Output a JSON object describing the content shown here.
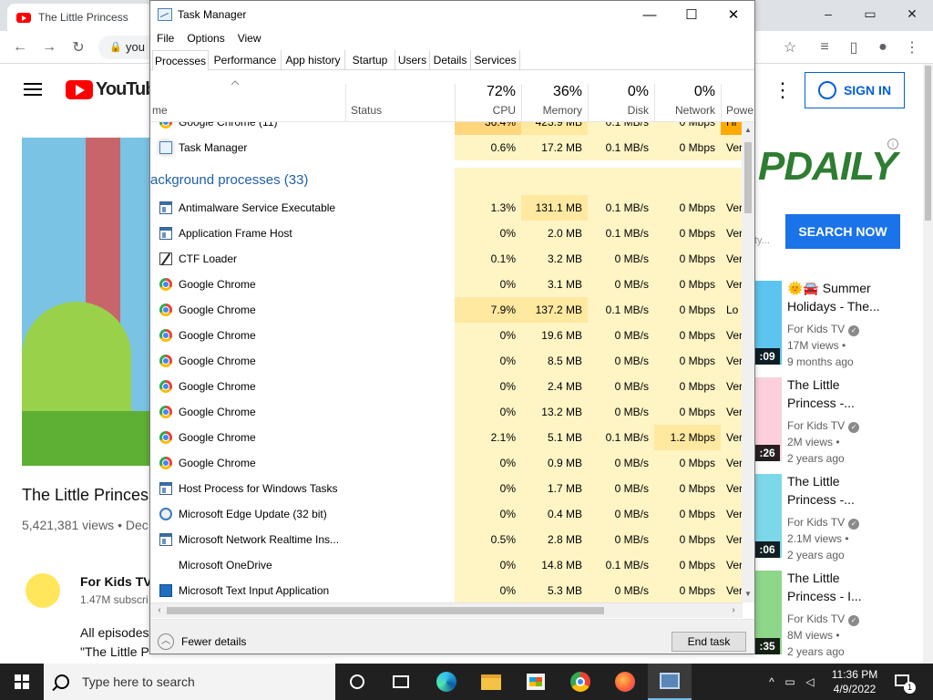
{
  "browser": {
    "tab_title": "The Little Princess",
    "url": "you",
    "window_controls": [
      "–",
      "▭",
      "✕"
    ]
  },
  "youtube": {
    "logo_text": "YouTube",
    "signin_label": "SIGN IN",
    "video_title": "The Little Princes",
    "video_views": "5,421,381 views • Dec",
    "channel_name": "For Kids TV",
    "channel_subs": "1.47M subscri",
    "desc_line1": "All episodes",
    "desc_line2": "\"The Little P",
    "ad_brand": "PDAILY",
    "ad_small": "ty...",
    "ad_button": "SEARCH NOW",
    "related": [
      {
        "line1": "🌞🚘 Summer",
        "line2": "Holidays - The...",
        "channel": "For Kids TV",
        "views": "17M views •",
        "ago": "9 months ago",
        "duration": ":09"
      },
      {
        "line1": "The Little",
        "line2": "Princess -...",
        "channel": "For Kids TV",
        "views": "2M views •",
        "ago": "2 years ago",
        "duration": ":26"
      },
      {
        "line1": "The Little",
        "line2": "Princess -...",
        "channel": "For Kids TV",
        "views": "2.1M views •",
        "ago": "2 years ago",
        "duration": ":06"
      },
      {
        "line1": "The Little",
        "line2": "Princess - I...",
        "channel": "For Kids TV",
        "views": "8M views •",
        "ago": "2 years ago",
        "duration": ":35"
      }
    ]
  },
  "taskmanager": {
    "title": "Task Manager",
    "window_controls": [
      "—",
      "☐",
      "✕"
    ],
    "menu": [
      "File",
      "Options",
      "View"
    ],
    "tabs": [
      "Processes",
      "Performance",
      "App history",
      "Startup",
      "Users",
      "Details",
      "Services"
    ],
    "active_tab": "Processes",
    "columns": {
      "name": "me",
      "status": "Status",
      "cpu_pct": "72%",
      "cpu": "CPU",
      "mem_pct": "36%",
      "mem": "Memory",
      "disk_pct": "0%",
      "disk": "Disk",
      "net_pct": "0%",
      "net": "Network",
      "power": "Powe"
    },
    "partial_row": {
      "name": "Google Chrome (11)",
      "cpu": "36.4%",
      "mem": "423.9 MB",
      "disk": "0.1 MB/s",
      "net": "0 Mbps",
      "power": "Hi"
    },
    "apps_rows": [
      {
        "icon": "tm",
        "name": "Task Manager",
        "cpu": "0.6%",
        "mem": "17.2 MB",
        "disk": "0.1 MB/s",
        "net": "0 Mbps",
        "power": "Ver"
      }
    ],
    "group_title": "ackground processes (33)",
    "bg_rows": [
      {
        "icon": "win",
        "name": "Antimalware Service Executable",
        "cpu": "1.3%",
        "mem": "131.1 MB",
        "disk": "0.1 MB/s",
        "net": "0 Mbps",
        "power": "Ver"
      },
      {
        "icon": "win",
        "name": "Application Frame Host",
        "cpu": "0%",
        "mem": "2.0 MB",
        "disk": "0.1 MB/s",
        "net": "0 Mbps",
        "power": "Ver"
      },
      {
        "icon": "ctf",
        "name": "CTF Loader",
        "cpu": "0.1%",
        "mem": "3.2 MB",
        "disk": "0 MB/s",
        "net": "0 Mbps",
        "power": "Ver"
      },
      {
        "icon": "chrome",
        "name": "Google Chrome",
        "cpu": "0%",
        "mem": "3.1 MB",
        "disk": "0 MB/s",
        "net": "0 Mbps",
        "power": "Ver"
      },
      {
        "icon": "chrome",
        "name": "Google Chrome",
        "cpu": "7.9%",
        "mem": "137.2 MB",
        "disk": "0.1 MB/s",
        "net": "0 Mbps",
        "power": "Lo"
      },
      {
        "icon": "chrome",
        "name": "Google Chrome",
        "cpu": "0%",
        "mem": "19.6 MB",
        "disk": "0 MB/s",
        "net": "0 Mbps",
        "power": "Ver"
      },
      {
        "icon": "chrome",
        "name": "Google Chrome",
        "cpu": "0%",
        "mem": "8.5 MB",
        "disk": "0 MB/s",
        "net": "0 Mbps",
        "power": "Ver"
      },
      {
        "icon": "chrome",
        "name": "Google Chrome",
        "cpu": "0%",
        "mem": "2.4 MB",
        "disk": "0 MB/s",
        "net": "0 Mbps",
        "power": "Ver"
      },
      {
        "icon": "chrome",
        "name": "Google Chrome",
        "cpu": "0%",
        "mem": "13.2 MB",
        "disk": "0 MB/s",
        "net": "0 Mbps",
        "power": "Ver"
      },
      {
        "icon": "chrome",
        "name": "Google Chrome",
        "cpu": "2.1%",
        "mem": "5.1 MB",
        "disk": "0.1 MB/s",
        "net": "1.2 Mbps",
        "power": "Ver"
      },
      {
        "icon": "chrome",
        "name": "Google Chrome",
        "cpu": "0%",
        "mem": "0.9 MB",
        "disk": "0 MB/s",
        "net": "0 Mbps",
        "power": "Ver"
      },
      {
        "icon": "win",
        "name": "Host Process for Windows Tasks",
        "cpu": "0%",
        "mem": "1.7 MB",
        "disk": "0 MB/s",
        "net": "0 Mbps",
        "power": "Ver"
      },
      {
        "icon": "edge",
        "name": "Microsoft Edge Update (32 bit)",
        "cpu": "0%",
        "mem": "0.4 MB",
        "disk": "0 MB/s",
        "net": "0 Mbps",
        "power": "Ver"
      },
      {
        "icon": "win",
        "name": "Microsoft Network Realtime Ins...",
        "cpu": "0.5%",
        "mem": "2.8 MB",
        "disk": "0 MB/s",
        "net": "0 Mbps",
        "power": "Ver"
      },
      {
        "icon": "none",
        "name": "Microsoft OneDrive",
        "cpu": "0%",
        "mem": "14.8 MB",
        "disk": "0.1 MB/s",
        "net": "0 Mbps",
        "power": "Ver"
      },
      {
        "icon": "text",
        "name": "Microsoft Text Input Application",
        "cpu": "0%",
        "mem": "5.3 MB",
        "disk": "0 MB/s",
        "net": "0 Mbps",
        "power": "Ver"
      }
    ],
    "fewer_details": "Fewer details",
    "end_task": "End task"
  },
  "taskbar": {
    "search_placeholder": "Type here to search",
    "time": "11:36 PM",
    "date": "4/9/2022",
    "notification_count": "1"
  }
}
